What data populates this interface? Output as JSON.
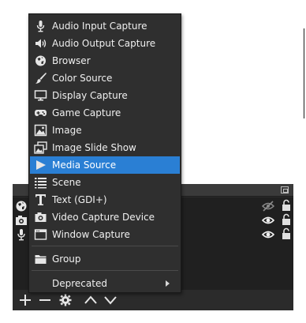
{
  "menu": {
    "items": [
      {
        "label": "Audio Input Capture",
        "icon": "microphone-icon"
      },
      {
        "label": "Audio Output Capture",
        "icon": "speaker-icon"
      },
      {
        "label": "Browser",
        "icon": "globe-icon"
      },
      {
        "label": "Color Source",
        "icon": "paintbrush-icon"
      },
      {
        "label": "Display Capture",
        "icon": "monitor-icon"
      },
      {
        "label": "Game Capture",
        "icon": "gamepad-icon"
      },
      {
        "label": "Image",
        "icon": "image-icon"
      },
      {
        "label": "Image Slide Show",
        "icon": "slideshow-icon"
      },
      {
        "label": "Media Source",
        "icon": "play-icon",
        "highlighted": true
      },
      {
        "label": "Scene",
        "icon": "list-icon"
      },
      {
        "label": "Text (GDI+)",
        "icon": "text-icon"
      },
      {
        "label": "Video Capture Device",
        "icon": "camera-icon"
      },
      {
        "label": "Window Capture",
        "icon": "window-icon"
      }
    ],
    "group": {
      "label": "Group",
      "icon": "folder-icon"
    },
    "deprecated": {
      "label": "Deprecated",
      "icon": "submenu-arrow-icon"
    }
  },
  "sources_dock": {
    "rows": [
      {
        "icon": "globe-icon",
        "visibility": "hidden-eye-icon",
        "lock": "lock-icon"
      },
      {
        "icon": "camera-icon",
        "visibility": "eye-icon",
        "lock": "lock-icon"
      },
      {
        "icon": "microphone-icon",
        "visibility": "eye-icon",
        "lock": "lock-icon"
      }
    ],
    "toolbar": [
      "add-icon",
      "remove-icon",
      "gear-icon",
      "move-up-icon",
      "move-down-icon"
    ]
  },
  "colors": {
    "menu_bg": "#2f2f2f",
    "highlight": "#2a7fd4",
    "dock_bg": "#202020",
    "text": "#f0f0f0"
  }
}
